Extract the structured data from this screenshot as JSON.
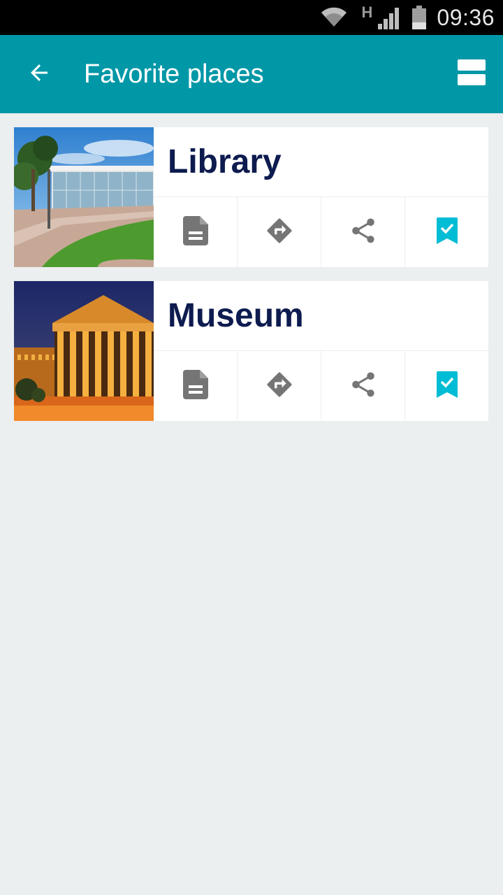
{
  "status_bar": {
    "network_type": "H",
    "time": "09:36"
  },
  "app_bar": {
    "title": "Favorite places",
    "back_icon": "arrow-back-icon",
    "view_toggle_icon": "view-stream-icon",
    "background_color": "#0097a7"
  },
  "places": [
    {
      "name": "Library"
    },
    {
      "name": "Museum"
    }
  ],
  "actions": {
    "details_icon": "document-icon",
    "directions_icon": "directions-icon",
    "share_icon": "share-icon",
    "bookmark_icon": "bookmark-check-icon",
    "icon_color": "#757575",
    "bookmark_color": "#00bcd4"
  },
  "text_color": "#0d1b4f"
}
